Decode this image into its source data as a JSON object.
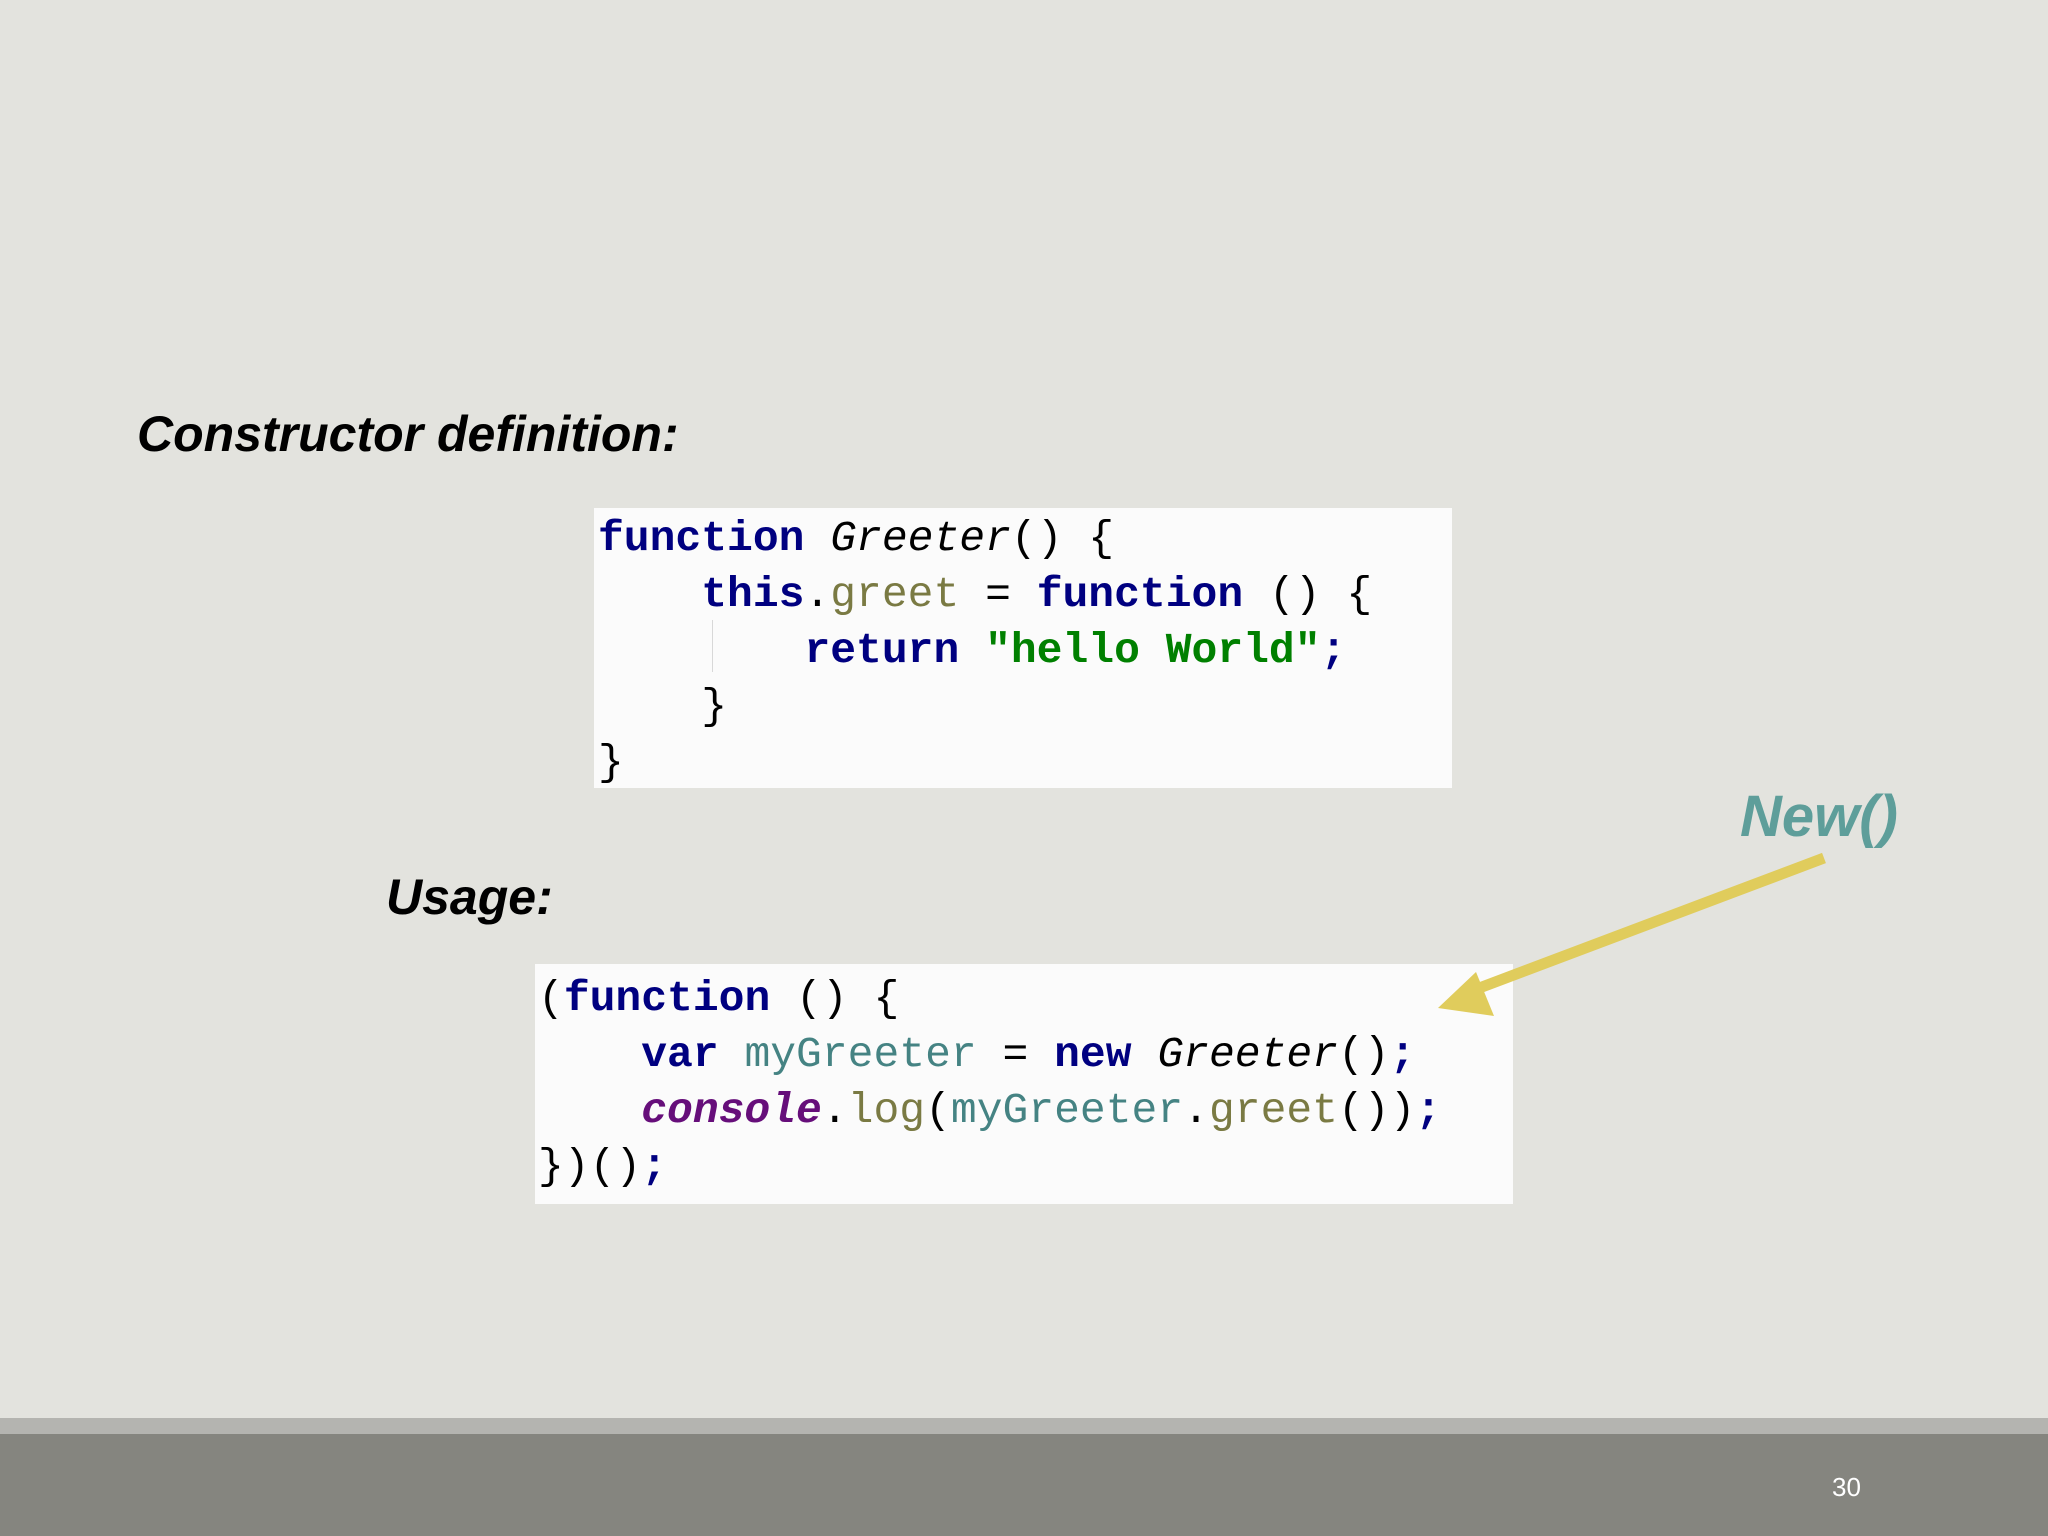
{
  "headings": {
    "constructor": "Constructor definition:",
    "usage": "Usage:"
  },
  "code_constructor": [
    [
      {
        "t": "function",
        "c": "kw"
      },
      {
        "t": " ",
        "c": ""
      },
      {
        "t": "Greeter",
        "c": "fn-it"
      },
      {
        "t": "() {",
        "c": "ident"
      }
    ],
    [
      {
        "t": "    ",
        "c": ""
      },
      {
        "t": "this",
        "c": "kw"
      },
      {
        "t": ".",
        "c": "ident"
      },
      {
        "t": "greet",
        "c": "prop"
      },
      {
        "t": " = ",
        "c": "ident"
      },
      {
        "t": "function",
        "c": "kw"
      },
      {
        "t": " () {",
        "c": "ident"
      }
    ],
    [
      {
        "t": "        ",
        "c": ""
      },
      {
        "t": "return",
        "c": "kw"
      },
      {
        "t": " ",
        "c": ""
      },
      {
        "t": "\"hello World\"",
        "c": "str"
      },
      {
        "t": ";",
        "c": "kw"
      }
    ],
    [
      {
        "t": "    ",
        "c": ""
      },
      {
        "t": "}",
        "c": "ident"
      }
    ],
    [
      {
        "t": "}",
        "c": "ident"
      }
    ]
  ],
  "code_usage": [
    [
      {
        "t": "(",
        "c": "ident"
      },
      {
        "t": "function",
        "c": "kw"
      },
      {
        "t": " () {",
        "c": "ident"
      }
    ],
    [
      {
        "t": "    ",
        "c": ""
      },
      {
        "t": "var",
        "c": "kw"
      },
      {
        "t": " ",
        "c": ""
      },
      {
        "t": "myGreeter",
        "c": "var"
      },
      {
        "t": " = ",
        "c": "ident"
      },
      {
        "t": "new",
        "c": "kw"
      },
      {
        "t": " ",
        "c": ""
      },
      {
        "t": "Greeter",
        "c": "fn-it"
      },
      {
        "t": "()",
        "c": "ident"
      },
      {
        "t": ";",
        "c": "kw"
      }
    ],
    [
      {
        "t": "    ",
        "c": ""
      },
      {
        "t": "console",
        "c": "glob"
      },
      {
        "t": ".",
        "c": "ident"
      },
      {
        "t": "log",
        "c": "prop"
      },
      {
        "t": "(",
        "c": "ident"
      },
      {
        "t": "myGreeter",
        "c": "var"
      },
      {
        "t": ".",
        "c": "ident"
      },
      {
        "t": "greet",
        "c": "prop"
      },
      {
        "t": "())",
        "c": "ident"
      },
      {
        "t": ";",
        "c": "kw"
      }
    ],
    [
      {
        "t": "})()",
        "c": "ident"
      },
      {
        "t": ";",
        "c": "kw"
      }
    ]
  ],
  "annotation": {
    "label": "New()",
    "color": "#5e9e9a",
    "arrow_color": "#e0cc5c"
  },
  "footer": {
    "slide_number": "30"
  }
}
